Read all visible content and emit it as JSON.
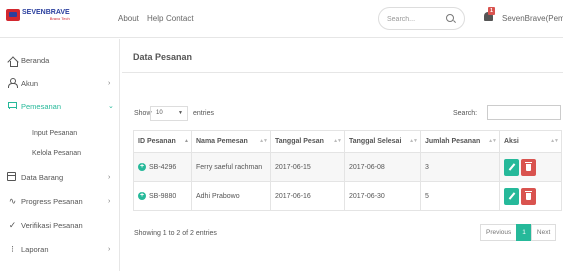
{
  "header": {
    "logo_text": "SEVENBRAVE",
    "logo_subtext": "Bravo Tech",
    "links": [
      "About",
      "Help",
      "Contact"
    ],
    "search_placeholder": "Search...",
    "notification_count": "1",
    "user_name": "SevenBrave(Pemilik)"
  },
  "sidebar": {
    "items": [
      {
        "label": "Beranda",
        "icon": "home-icon",
        "chevron": false
      },
      {
        "label": "Akun",
        "icon": "user-icon",
        "chevron": true
      },
      {
        "label": "Pemesanan",
        "icon": "cart-icon",
        "chevron": true,
        "active": true
      },
      {
        "label": "Data Barang",
        "icon": "calendar-icon",
        "chevron": true
      },
      {
        "label": "Progress Pesanan",
        "icon": "pulse-icon",
        "chevron": true
      },
      {
        "label": "Verifikasi Pesanan",
        "icon": "check-icon",
        "chevron": false
      },
      {
        "label": "Laporan",
        "icon": "report-icon",
        "chevron": true
      }
    ],
    "sub_items": [
      "Input Pesanan",
      "Kelola Pesanan"
    ]
  },
  "main": {
    "title": "Data Pesanan",
    "show_label": "Show",
    "page_length": "10",
    "entries_label": "entries",
    "search_label": "Search:",
    "table": {
      "columns": [
        "ID Pesanan",
        "Nama Pemesan",
        "Tanggal Pesan",
        "Tanggal Selesai",
        "Jumlah Pesanan",
        "Aksi"
      ],
      "rows": [
        [
          "SB-4296",
          "Ferry saeful rachman",
          "2017-06-15",
          "2017-06-08",
          "3"
        ],
        [
          "SB-9880",
          "Adhi Prabowo",
          "2017-06-16",
          "2017-06-30",
          "5"
        ]
      ]
    },
    "info": "Showing 1 to 2 of 2 entries",
    "pagination": {
      "previous": "Previous",
      "current": "1",
      "next": "Next"
    }
  },
  "colors": {
    "accent": "#26b99a",
    "danger": "#d9534f",
    "brand": "#2a3f9e"
  }
}
